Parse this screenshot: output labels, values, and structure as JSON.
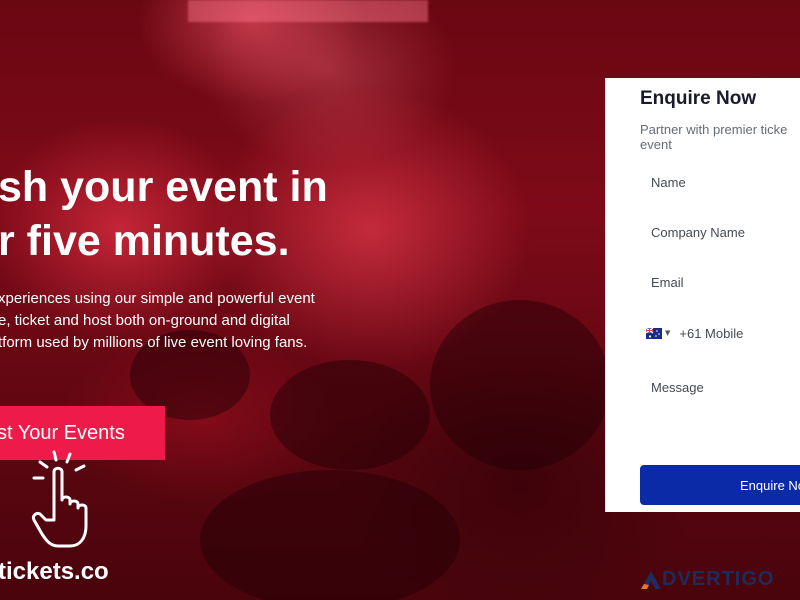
{
  "hero": {
    "headline_line1": "sh your event in",
    "headline_line2": "r five minutes.",
    "body_line1": "xperiences using our simple and powerful event",
    "body_line2": "e, ticket and host both on-ground and digital",
    "body_line3": "tform used by millions of live event loving fans.",
    "cta_label": "st Your Events",
    "brand_text": "tickets.co"
  },
  "form": {
    "title": "Enquire Now",
    "subtitle_line1": "Partner with premier ticke",
    "subtitle_line2": "event",
    "fields": {
      "name": "Name",
      "company": "Company Name",
      "email": "Email",
      "phone": "+61 Mobile",
      "message": "Message"
    },
    "submit_label": "Enquire No"
  },
  "icons": {
    "hand": "hand-pointer-icon",
    "flag": "australia-flag-icon",
    "caret": "caret-down-icon"
  },
  "colors": {
    "cta": "#ee1a4a",
    "submit": "#0b2aa6",
    "background": "#6a0812"
  },
  "watermark": {
    "text": "DVERTIGO"
  }
}
